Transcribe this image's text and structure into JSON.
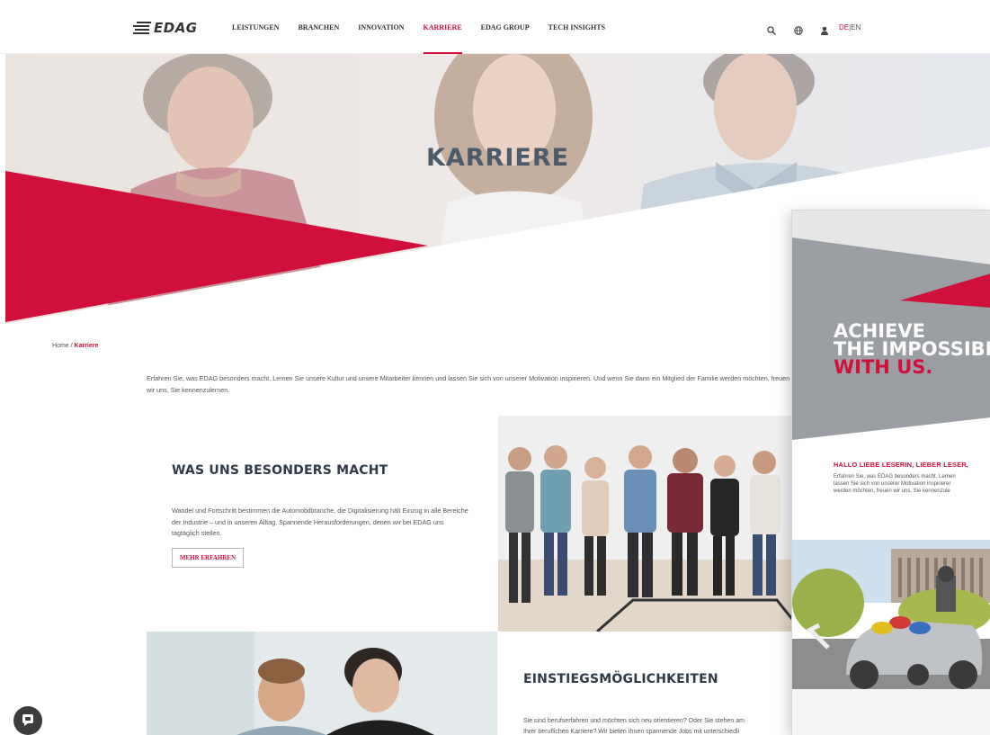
{
  "nav": {
    "logo_text": "EDAG",
    "items": [
      {
        "label": "LEISTUNGEN"
      },
      {
        "label": "BRANCHEN"
      },
      {
        "label": "INNOVATION"
      },
      {
        "label": "KARRIERE"
      },
      {
        "label": "EDAG GROUP"
      },
      {
        "label": "TECH INSIGHTS"
      }
    ],
    "active_item": "KARRIERE",
    "icons": [
      "search-icon",
      "globe-icon",
      "user-icon"
    ],
    "lang_de": "DE",
    "lang_sep": "|",
    "lang_en": "EN"
  },
  "hero": {
    "title": "KARRIERE"
  },
  "breadcrumb": {
    "home": "Home",
    "separator": " / ",
    "current": "Karriere"
  },
  "intro": {
    "text": "Erfahren Sie, was EDAG besonders macht. Lernen Sie unsere Kultur und unsere Mitarbeiter kennen und lassen Sie sich von unserer Motivation inspirieren. Und wenn Sie dann ein Mitglied der Familie werden möchten, freuen wir uns, Sie kennenzulernen."
  },
  "section1": {
    "heading": "WAS UNS BESONDERS MACHT",
    "paragraph": "Wandel und Fortschritt bestimmen die Automobilbranche, die Digitalisierung hält Einzug in alle Bereiche der Industrie – und in unseren Alltag. Spannende Herausforderungen, denen wir bei EDAG uns tagtäglich stellen.",
    "button": "MEHR ERFAHREN"
  },
  "section2": {
    "heading": "EINSTIEGSMÖGLICHKEITEN",
    "paragraph_line1": "Sie sind berufserfahren und möchten sich neu orientieren? Oder Sie stehen am",
    "paragraph_line2": "Ihrer beruflichen Karriere? Wir bieten Ihnen spannende Jobs mit unterschiedli"
  },
  "brochure": {
    "headline_line1": "ACHIEVE",
    "headline_line2": "THE IMPOSSIBI",
    "headline_line3": "WITH US.",
    "subheading": "HALLO LIEBE LESERIN, LIEBER LESER,",
    "text_line1": "Erfahren Sie, was EDAG besonders macht. Lernen",
    "text_line2": "lassen Sie sich von unserer Motivation inspirierer",
    "text_line3": "werden möchten, freuen wir uns, Sie kennenzule"
  },
  "colors": {
    "accent": "#d0103a",
    "text_dark": "#2f3a46",
    "hero_title": "#4c5a69"
  }
}
